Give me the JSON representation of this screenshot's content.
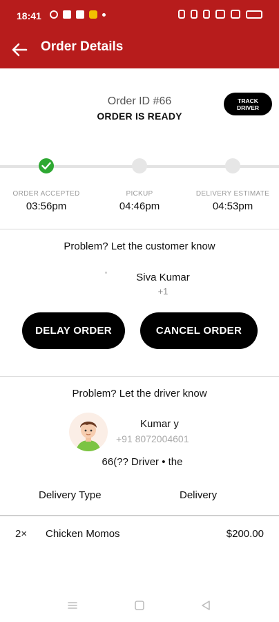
{
  "status_bar": {
    "time": "18:41"
  },
  "app_bar": {
    "title": "Order Details",
    "back_icon": "arrow-left-icon"
  },
  "order": {
    "id_label": "Order ID #66",
    "status": "ORDER IS READY",
    "track_button_line1": "TRACK",
    "track_button_line2": "DRIVER"
  },
  "progress": {
    "steps": [
      {
        "label": "ORDER ACCEPTED",
        "time": "03:56pm",
        "completed": true
      },
      {
        "label": "PICKUP",
        "time": "04:46pm",
        "completed": false
      },
      {
        "label": "DELIVERY ESTIMATE",
        "time": "04:53pm",
        "completed": false
      }
    ],
    "done_color": "#2ea832"
  },
  "customer": {
    "section_title": "Problem? Let the customer know",
    "name": "Siva Kumar",
    "phone": "+1",
    "delay_button": "DELAY ORDER",
    "cancel_button": "CANCEL ORDER"
  },
  "driver": {
    "section_title": "Problem? Let the driver know",
    "name": "Kumar y",
    "phone": "+91 8072004601",
    "note": "66(??  Driver • the"
  },
  "delivery": {
    "type_label": "Delivery Type",
    "type_value": "Delivery"
  },
  "items": [
    {
      "qty": "2×",
      "name": "Chicken Momos",
      "price": "$200.00"
    }
  ],
  "colors": {
    "brand": "#b71c1c",
    "button": "#000000"
  }
}
